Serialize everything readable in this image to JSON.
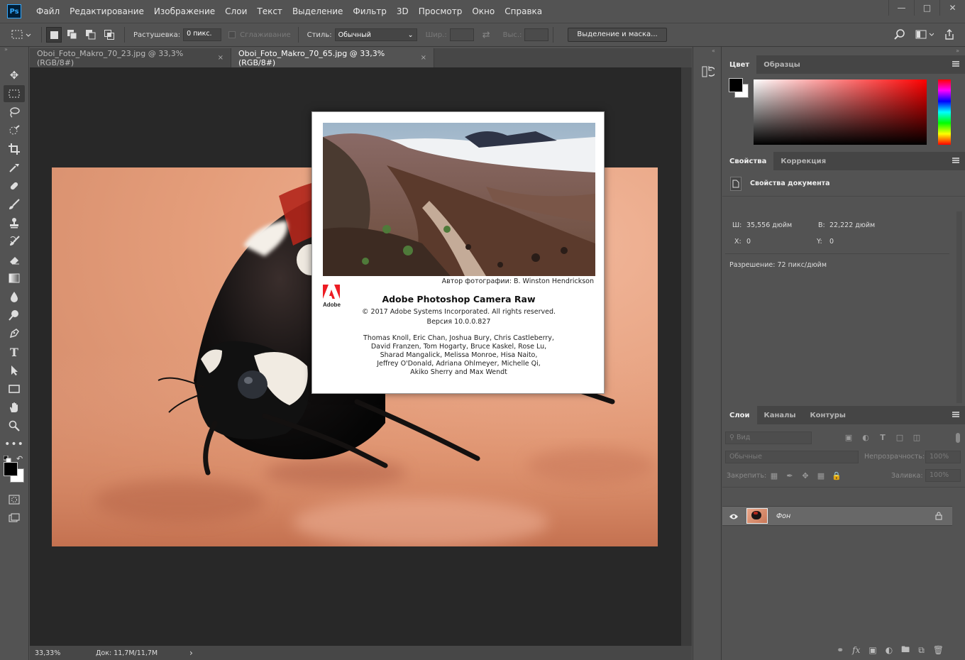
{
  "app": {
    "logo": "Ps"
  },
  "menu": [
    "Файл",
    "Редактирование",
    "Изображение",
    "Слои",
    "Текст",
    "Выделение",
    "Фильтр",
    "3D",
    "Просмотр",
    "Окно",
    "Справка"
  ],
  "options": {
    "feather_label": "Растушевка:",
    "feather_value": "0 пикс.",
    "antialias_label": "Сглаживание",
    "style_label": "Стиль:",
    "style_value": "Обычный",
    "width_label": "Шир.:",
    "height_label": "Выс.:",
    "select_mask_button": "Выделение и маска..."
  },
  "tabs": [
    {
      "label": "Oboi_Foto_Makro_70_23.jpg @ 33,3% (RGB/8#)",
      "close": "×"
    },
    {
      "label": "Oboi_Foto_Makro_70_65.jpg @ 33,3% (RGB/8#)",
      "close": "×"
    }
  ],
  "status": {
    "zoom": "33,33%",
    "doc": "Док: 11,7M/11,7M",
    "arrow": "›"
  },
  "about": {
    "credit": "Автор фотографии: B. Winston Hendrickson",
    "logo_text": "Adobe",
    "title": "Adobe Photoshop Camera Raw",
    "copyright": "© 2017 Adobe Systems Incorporated. All rights reserved.",
    "version": "Версия 10.0.0.827",
    "authors": [
      "Thomas Knoll, Eric Chan, Joshua Bury, Chris Castleberry,",
      "David Franzen, Tom Hogarty, Bruce Kaskel, Rose Lu,",
      "Sharad Mangalick, Melissa Monroe, Hisa Naito,",
      "Jeffrey O'Donald, Adriana Ohlmeyer, Michelle Qi,",
      "Akiko Sherry and Max Wendt"
    ]
  },
  "color_panel": {
    "tabs": [
      "Цвет",
      "Образцы"
    ]
  },
  "properties_panel": {
    "tabs": [
      "Свойства",
      "Коррекция"
    ],
    "heading": "Свойства документа",
    "w_label": "Ш:",
    "w_value": "35,556 дюйм",
    "h_label": "В:",
    "h_value": "22,222 дюйм",
    "x_label": "X:",
    "x_value": "0",
    "y_label": "Y:",
    "y_value": "0",
    "resolution": "Разрешение: 72 пикс/дюйм"
  },
  "layers_panel": {
    "tabs": [
      "Слои",
      "Каналы",
      "Контуры"
    ],
    "search_placeholder": "Вид",
    "blend_mode": "Обычные",
    "opacity_label": "Непрозрачность:",
    "opacity_value": "100%",
    "lock_label": "Закрепить:",
    "fill_label": "Заливка:",
    "fill_value": "100%",
    "layer_name": "Фон"
  },
  "colors": {
    "background": "#535353",
    "canvas": "#282828",
    "accent": "#31a8ff",
    "adobe_red": "#ed1c24"
  }
}
